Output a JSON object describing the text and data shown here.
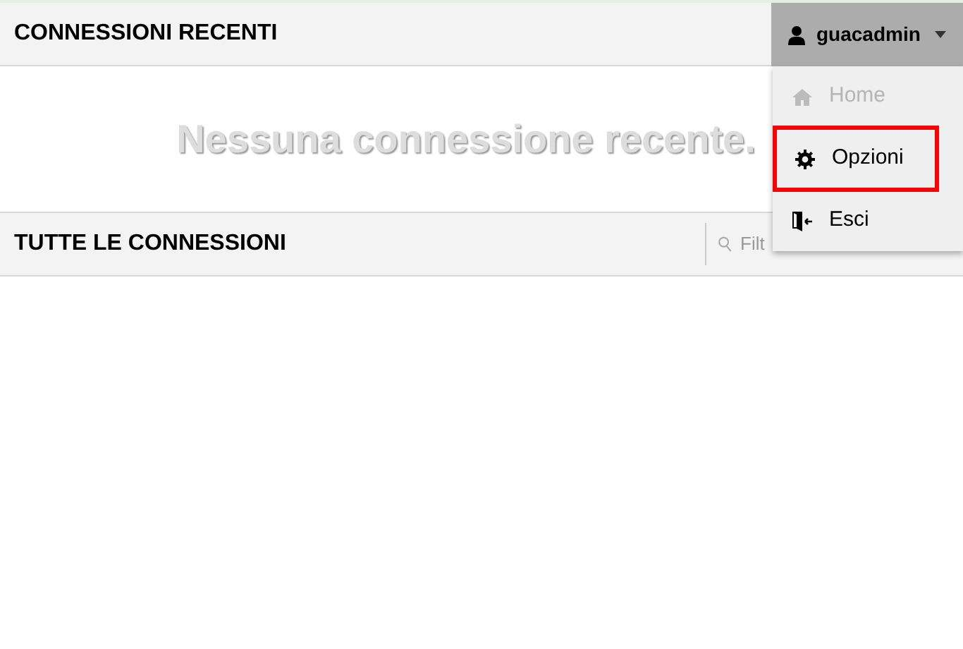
{
  "recent": {
    "title": "CONNESSIONI RECENTI",
    "empty_message": "Nessuna connessione recente."
  },
  "all": {
    "title": "TUTTE LE CONNESSIONI",
    "filter": {
      "placeholder": "Filt"
    }
  },
  "user_menu": {
    "username": "guacadmin",
    "expanded": true,
    "items": [
      {
        "kind": "home",
        "label": "Home",
        "disabled": true,
        "highlighted": false
      },
      {
        "kind": "options",
        "label": "Opzioni",
        "disabled": false,
        "highlighted": true
      },
      {
        "kind": "logout",
        "label": "Esci",
        "disabled": false,
        "highlighted": false
      }
    ]
  }
}
